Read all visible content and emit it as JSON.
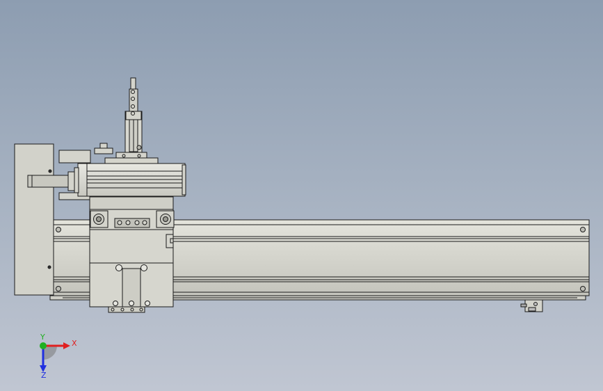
{
  "viewport": {
    "background_top": "#8d9db1",
    "background_bottom": "#c0c6d2",
    "part_color": "#d4d4cc",
    "edge_color": "#1a1a1a"
  },
  "triad": {
    "x_label": "X",
    "y_label": "Y",
    "z_label": "Z",
    "x_color": "#e02020",
    "y_color": "#20b020",
    "z_color": "#2030e0"
  }
}
